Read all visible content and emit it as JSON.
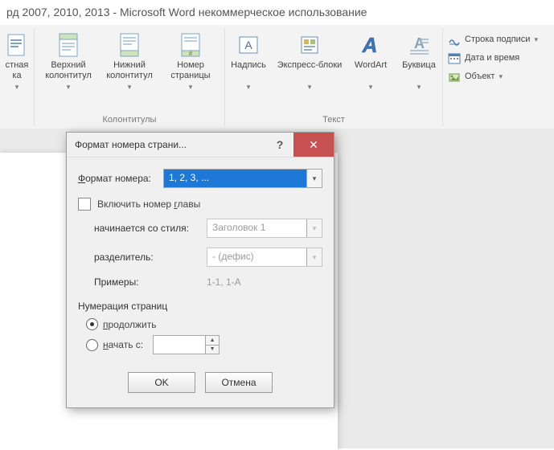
{
  "window": {
    "title": "рд 2007, 2010, 2013  -  Microsoft Word некоммерческое использование"
  },
  "ribbon": {
    "group_cut": {
      "btn0": "стная\nка"
    },
    "headers_footers": {
      "header": "Верхний\nколонтитул",
      "footer": "Нижний\nколонтитул",
      "page_number": "Номер\nстраницы",
      "group_label": "Колонтитулы"
    },
    "text": {
      "textbox": "Надпись",
      "quick_parts": "Экспресс-блоки",
      "wordart": "WordArt",
      "dropcap": "Буквица",
      "group_label": "Текст"
    },
    "side": {
      "signature": "Строка подписи",
      "datetime": "Дата и время",
      "object": "Объект"
    }
  },
  "dialog": {
    "title": "Формат номера страни...",
    "format_label": "Формат номера:",
    "format_value": "1, 2, 3, ...",
    "include_chapter": "Включить номер главы",
    "starts_with_style_label": "начинается со стиля:",
    "starts_with_style_value": "Заголовок 1",
    "separator_label": "разделитель:",
    "separator_value": "-   (дефис)",
    "examples_label": "Примеры:",
    "examples_value": "1-1, 1-A",
    "numbering_label": "Нумерация страниц",
    "radio_continue": "продолжить",
    "radio_start_at": "начать с:",
    "start_at_value": "",
    "ok": "OK",
    "cancel": "Отмена"
  }
}
